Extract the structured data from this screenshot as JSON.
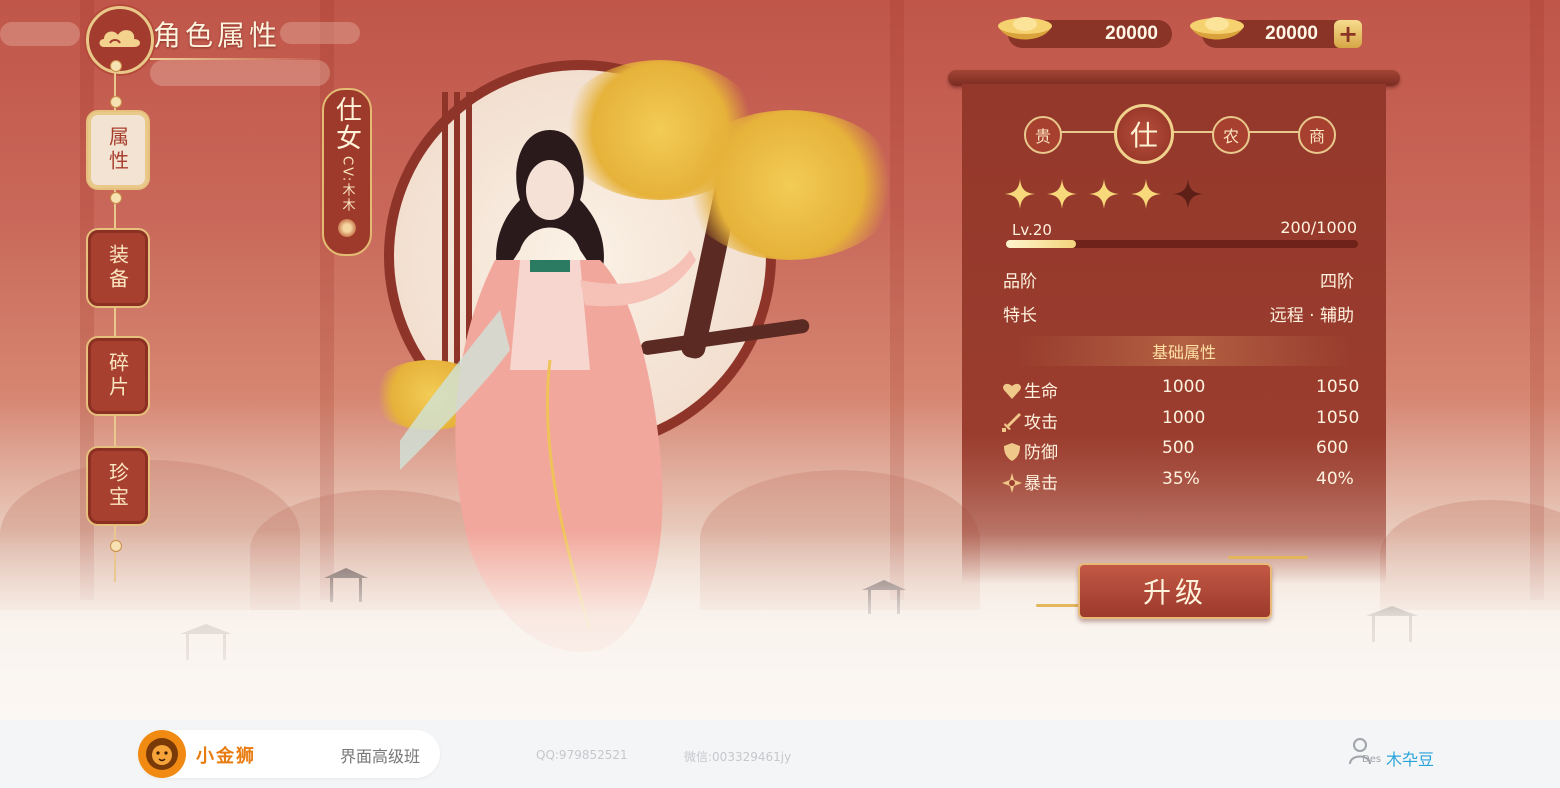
{
  "header": {
    "title": "角色属性"
  },
  "nav": {
    "items": [
      {
        "label": "属性",
        "active": true
      },
      {
        "label": "装备",
        "active": false
      },
      {
        "label": "碎片",
        "active": false
      },
      {
        "label": "珍宝",
        "active": false
      }
    ]
  },
  "character": {
    "name": "仕女",
    "cv": "CV:木木"
  },
  "currency": [
    {
      "icon": "gold-ingot-icon",
      "amount": "20000"
    },
    {
      "icon": "gold-ingot-icon",
      "amount": "20000"
    }
  ],
  "classes": [
    {
      "label": "贵",
      "active": false
    },
    {
      "label": "仕",
      "active": true
    },
    {
      "label": "农",
      "active": false
    },
    {
      "label": "商",
      "active": false
    }
  ],
  "rating": {
    "filled": 4,
    "total": 5
  },
  "level": {
    "label": "Lv.20",
    "xp_text": "200/1000",
    "progress": 0.2
  },
  "info": [
    {
      "label": "品阶",
      "value": "四阶"
    },
    {
      "label": "特长",
      "value": "远程 · 辅助"
    }
  ],
  "stats_section": {
    "title": "基础属性"
  },
  "stats": [
    {
      "icon": "heart-icon",
      "name": "生命",
      "current": "1000",
      "next": "1050"
    },
    {
      "icon": "sword-icon",
      "name": "攻击",
      "current": "1000",
      "next": "1050"
    },
    {
      "icon": "shield-icon",
      "name": "防御",
      "current": "500",
      "next": "600"
    },
    {
      "icon": "crit-icon",
      "name": "暴击",
      "current": "35%",
      "next": "40%"
    }
  ],
  "upgrade": {
    "label": "升级"
  },
  "footer": {
    "brand_name": "小金狮",
    "course": "界面高级班",
    "qq": "QQ:979852521",
    "wechat": "微信:003329461jy",
    "author_tag": "Des",
    "author_name": "木卆豆"
  },
  "colors": {
    "primary": "#9a3d2f",
    "gold": "#e8c88c",
    "accent_orange": "#e87c10",
    "author_blue": "#29a3d8"
  }
}
